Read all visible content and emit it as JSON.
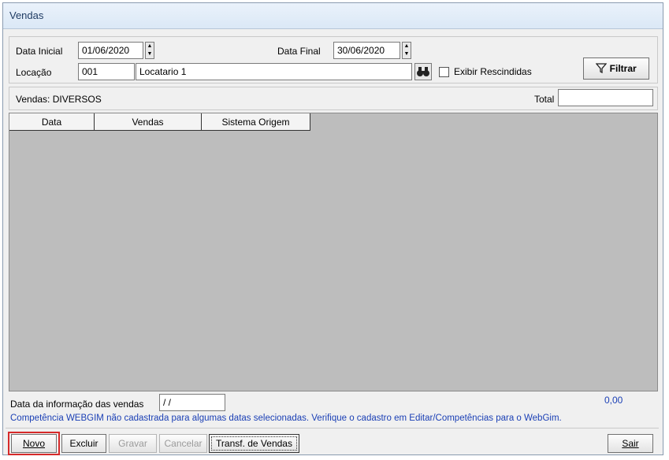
{
  "window": {
    "title": "Vendas"
  },
  "filters": {
    "data_inicial_label": "Data Inicial",
    "data_inicial_value": "01/06/2020",
    "data_final_label": "Data Final",
    "data_final_value": "30/06/2020",
    "locacao_label": "Locação",
    "locacao_code": "001",
    "locacao_name": "Locatario 1",
    "exibir_rescindidas_label": "Exibir Rescindidas",
    "filtrar_label": "Filtrar"
  },
  "summary": {
    "vendas_label": "Vendas: DIVERSOS",
    "total_label": "Total",
    "total_value": ""
  },
  "table": {
    "columns": [
      "Data",
      "Vendas",
      "Sistema Origem"
    ],
    "rows": []
  },
  "footer": {
    "data_informacao_label": "Data da informação das vendas",
    "data_informacao_value": " /  /",
    "total_amount": "0,00",
    "warning": "Competência WEBGIM não cadastrada para algumas datas selecionadas. Verifique o cadastro em Editar/Competências para o WebGim.",
    "warning_color": "#1a3fb5"
  },
  "buttons": {
    "novo": "Novo",
    "excluir": "Excluir",
    "gravar": "Gravar",
    "cancelar": "Cancelar",
    "transf": "Transf. de Vendas",
    "sair": "Sair"
  }
}
